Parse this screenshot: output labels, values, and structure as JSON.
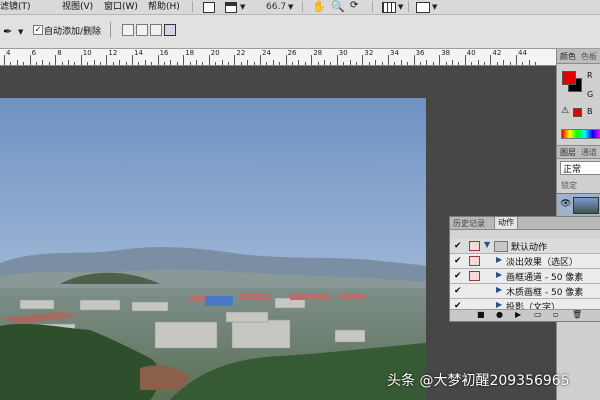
{
  "menubar": {
    "items": [
      "滤镜(T)",
      "视图(V)",
      "窗口(W)",
      "帮助(H)"
    ],
    "zoom": "66.7"
  },
  "options": {
    "auto_add_delete_label": "自动添加/删除",
    "auto_add_delete_checked": true
  },
  "ruler": {
    "labels": [
      "4",
      "6",
      "8",
      "10",
      "12",
      "14",
      "16",
      "18",
      "20",
      "22",
      "24",
      "26",
      "28",
      "30",
      "32",
      "34",
      "36",
      "38",
      "40",
      "42",
      "44"
    ]
  },
  "right_panel": {
    "tabs_top": [
      "颜色",
      "色板"
    ],
    "color_letters": [
      "R",
      "G",
      "B"
    ],
    "tabs_layers": [
      "图层",
      "通道"
    ],
    "blend_mode": "正常",
    "lock_label": "锁定"
  },
  "actions_panel": {
    "tabs": [
      "历史记录",
      "动作"
    ],
    "active_tab": "动作",
    "rows": [
      {
        "label": "默认动作",
        "type": "folder"
      },
      {
        "label": "淡出效果（选区）",
        "type": "action"
      },
      {
        "label": "画框通道 - 50 像素",
        "type": "action"
      },
      {
        "label": "木质画框 - 50 像素",
        "type": "action"
      },
      {
        "label": "投影（文字）",
        "type": "action"
      }
    ]
  },
  "watermark": "头条 @大梦初醒209356965",
  "colors": {
    "foreground": "#e00000",
    "background": "#000000",
    "ui_bg": "#d9d9d9"
  }
}
